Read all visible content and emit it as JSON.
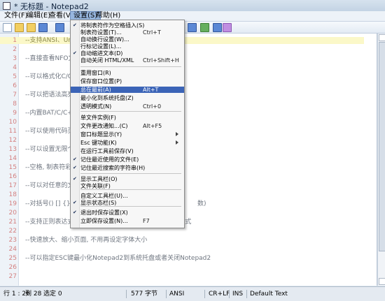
{
  "window": {
    "title": "* 无标题 - Notepad2"
  },
  "menubar": {
    "items": [
      "文件(F)",
      "编辑(E)",
      "查看(V)",
      "设置(S)",
      "帮助(H)"
    ]
  },
  "editor": {
    "lines": [
      "--支持ANSI、Un",
      "",
      "--直接查看NFO文",
      "",
      "--可以格式化C/C",
      "",
      "--可以把语法高亮",
      "",
      "--内置BAT/C/C+",
      "",
      "--可以使用代码页",
      "",
      "--可以设置无限个",
      "",
      "--空格, 制表符彩",
      "",
      "--可以对任意的文",
      "",
      "--对括号() [] {}可",
      "",
      "--支持正则表达式搜索和替换(Boost) --可以使用半透明模式",
      "",
      "--快速放大、缩小页面, 不用再设定字体大小",
      "",
      "--可以指定ESC键最小化Notepad2到系统托盘或者关闭Notepad2",
      "",
      ""
    ],
    "line_numbers": [
      "1",
      "2",
      "3",
      "4",
      "5",
      "6",
      "7",
      "8",
      "9",
      "10",
      "11",
      "12",
      "13",
      "14",
      "15",
      "16",
      "17",
      "18",
      "19",
      "20",
      "21",
      "22",
      "23",
      "24",
      "25",
      "26",
      "27"
    ],
    "current_line_index": 0,
    "line19_tail": "数)"
  },
  "settings_menu": {
    "items": [
      {
        "label": "将制表符作为空格插入(S)",
        "shortcut": "",
        "checked": true
      },
      {
        "label": "制表符设置(T)...",
        "shortcut": "Ctrl+T",
        "checked": false
      },
      {
        "label": "自动换行设置(W)...",
        "shortcut": "",
        "checked": false
      },
      {
        "label": "行标记设置(L)...",
        "shortcut": "",
        "checked": false
      },
      {
        "label": "自动缩进文本(D)",
        "shortcut": "",
        "checked": true
      },
      {
        "label": "自动关闭 HTML/XML",
        "shortcut": "Ctrl+Shift+H",
        "checked": false
      },
      {
        "label": "重用窗口(R)",
        "shortcut": "",
        "checked": false
      },
      {
        "label": "保存窗口位置(P)",
        "shortcut": "",
        "checked": false
      },
      {
        "label": "总在最前(A)",
        "shortcut": "Alt+T",
        "checked": false,
        "highlighted": true
      },
      {
        "label": "最小化到系统托盘(Z)",
        "shortcut": "",
        "checked": false
      },
      {
        "label": "透明模式(N)",
        "shortcut": "Ctrl+0",
        "checked": false
      },
      {
        "label": "单文件实例(F)",
        "shortcut": "",
        "checked": false
      },
      {
        "label": "文件更改通知...(C)",
        "shortcut": "Alt+F5",
        "checked": false
      },
      {
        "label": "窗口标题显示(Y)",
        "shortcut": "",
        "checked": false,
        "submenu": true
      },
      {
        "label": "Esc 键功能(K)",
        "shortcut": "",
        "checked": false,
        "submenu": true
      },
      {
        "label": "在运行工具前保存(V)",
        "shortcut": "",
        "checked": false
      },
      {
        "label": "记住最近使用的文件(E)",
        "shortcut": "",
        "checked": true
      },
      {
        "label": "记住最近搜索的字符串(H)",
        "shortcut": "",
        "checked": true
      },
      {
        "label": "显示工具栏(O)",
        "shortcut": "",
        "checked": true
      },
      {
        "label": "文件关联(F)",
        "shortcut": "",
        "checked": false
      },
      {
        "label": "自定义工具栏(U)...",
        "shortcut": "",
        "checked": false
      },
      {
        "label": "显示状态栏(S)",
        "shortcut": "",
        "checked": true
      },
      {
        "label": "退出时保存设置(X)",
        "shortcut": "",
        "checked": true
      },
      {
        "label": "立即保存设置(N)...",
        "shortcut": "F7",
        "checked": false
      }
    ]
  },
  "status": {
    "position": "行 1 : 26",
    "column": "列 28",
    "selection": "选定 0",
    "size": "577 字节",
    "encoding": "ANSI",
    "line_endings": "CR+LF",
    "mode": "INS",
    "scheme": "Default Text"
  }
}
